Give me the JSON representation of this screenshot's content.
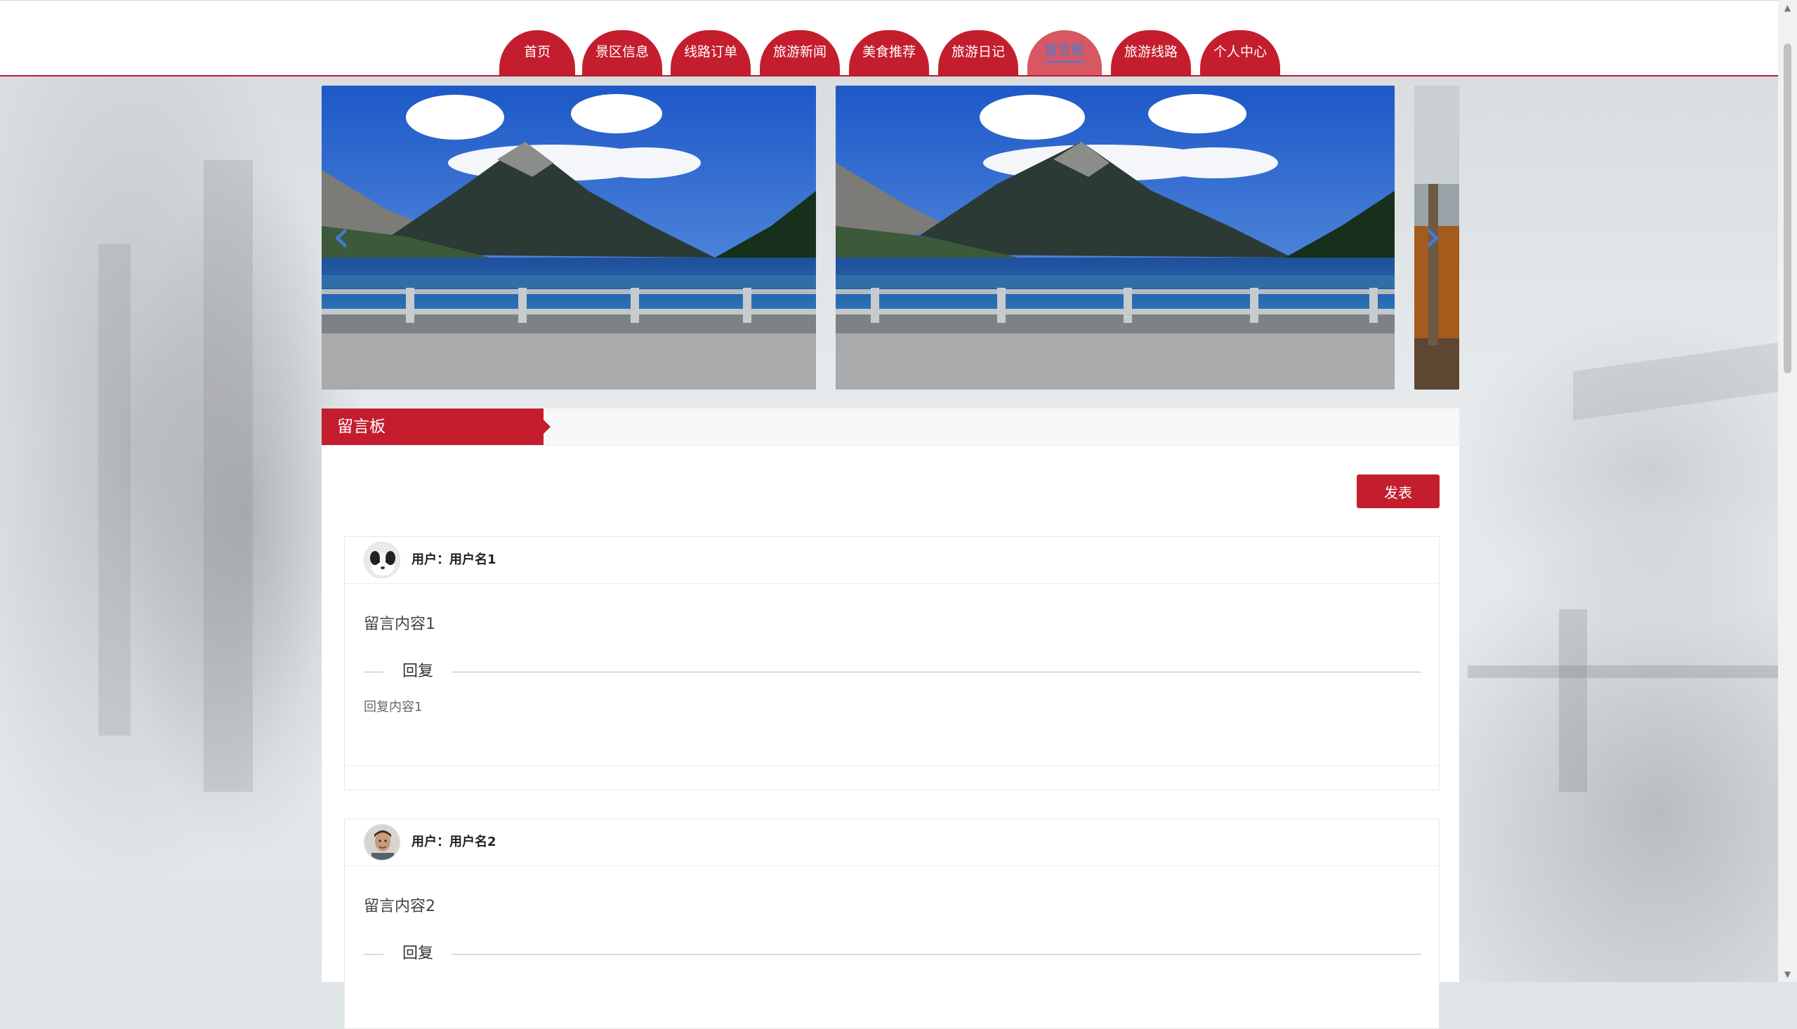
{
  "nav": {
    "items": [
      {
        "label": "首页"
      },
      {
        "label": "景区信息"
      },
      {
        "label": "线路订单"
      },
      {
        "label": "旅游新闻"
      },
      {
        "label": "美食推荐"
      },
      {
        "label": "旅游日记"
      },
      {
        "label": "留言板",
        "active": true
      },
      {
        "label": "旅游线路"
      },
      {
        "label": "个人中心"
      }
    ],
    "active_color": "#3d7fe0",
    "brand_color": "#c41e2e"
  },
  "carousel": {
    "prev_icon": "chevron-left-icon",
    "next_icon": "chevron-right-icon",
    "prev_glyph": "‹",
    "next_glyph": "›"
  },
  "board": {
    "title": "留言板",
    "post_button": "发表",
    "messages": [
      {
        "user_label": "用户：用户名1",
        "content": "留言内容1",
        "reply_label": "回复",
        "reply_content": "回复内容1",
        "avatar": "dog-avatar"
      },
      {
        "user_label": "用户：用户名2",
        "content": "留言内容2",
        "reply_label": "回复",
        "avatar": "man-avatar"
      }
    ]
  }
}
